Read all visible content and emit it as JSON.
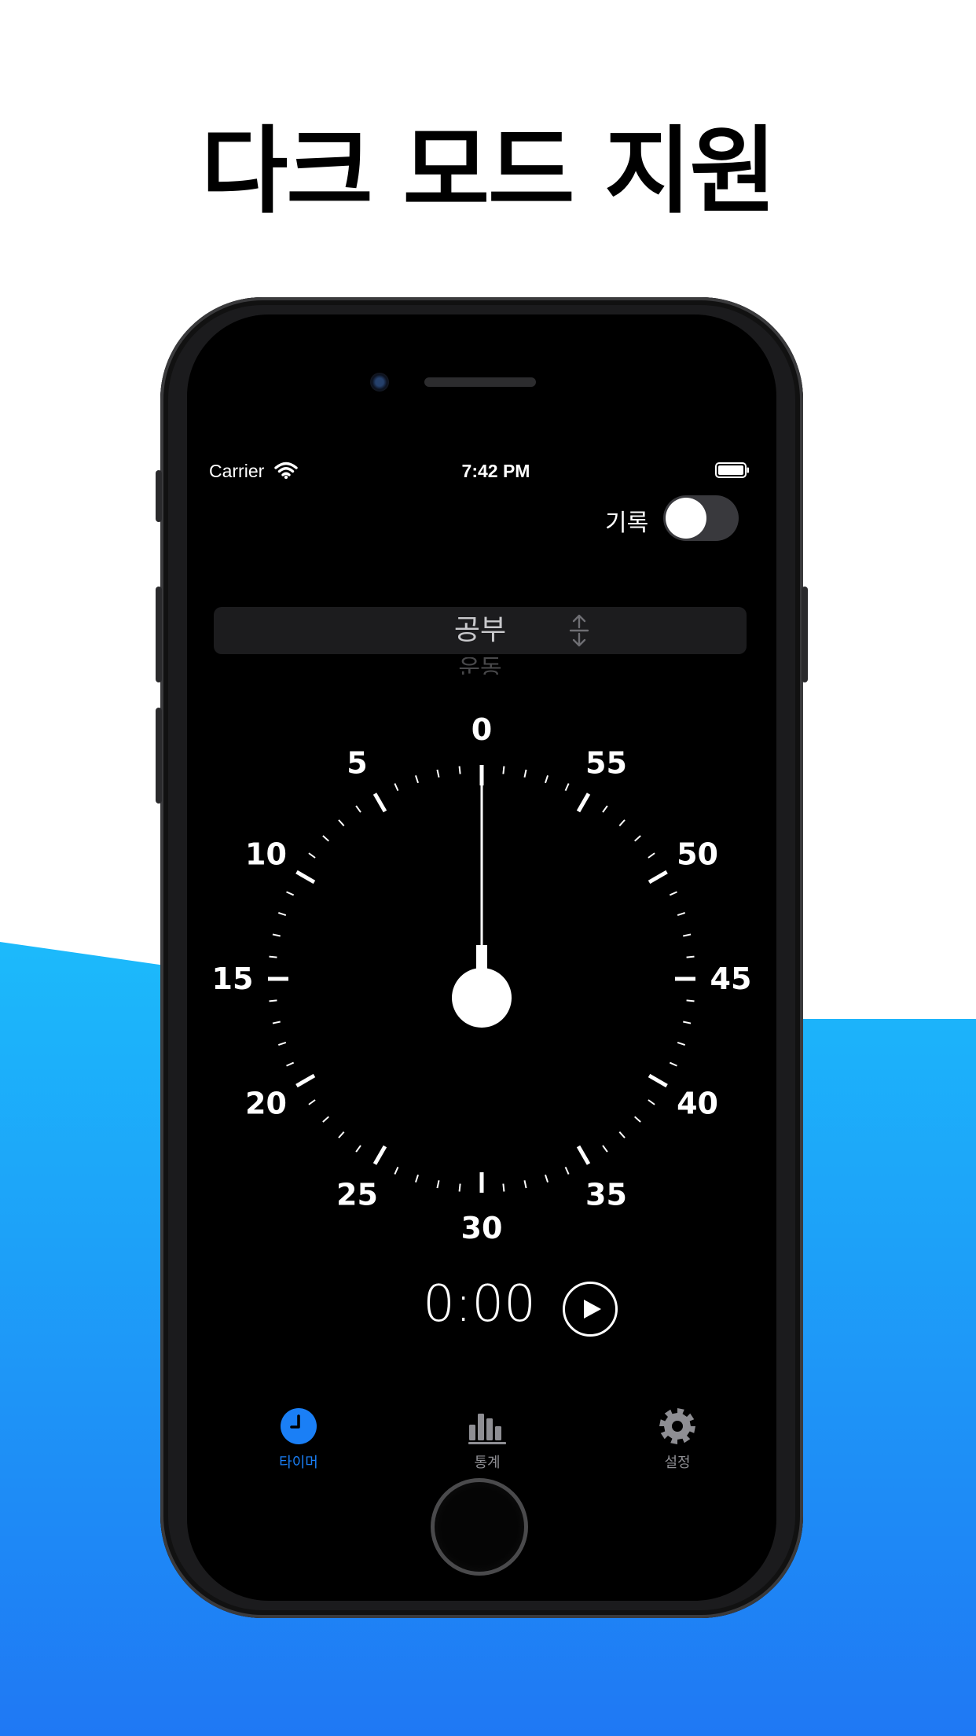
{
  "headline": "다크 모드 지원",
  "colors": {
    "accent": "#1a7ff6",
    "gradient_top": "#1cbafb",
    "gradient_bottom": "#1f78f4",
    "tab_inactive": "#8e8e93"
  },
  "status_bar": {
    "carrier": "Carrier",
    "time": "7:42 PM",
    "icons": [
      "wifi-icon",
      "battery-icon"
    ]
  },
  "record": {
    "label": "기록",
    "enabled": false
  },
  "mode_picker": {
    "selected": "공부",
    "next": "운동",
    "icon": "up-down-arrows-icon"
  },
  "dial": {
    "labels": [
      "0",
      "5",
      "10",
      "15",
      "20",
      "25",
      "30",
      "35",
      "40",
      "45",
      "50",
      "55"
    ],
    "hand_value_minutes": 0
  },
  "timer": {
    "display": "0:00",
    "play_icon": "play-icon"
  },
  "tabs": [
    {
      "label": "타이머",
      "icon": "clock-icon",
      "active": true
    },
    {
      "label": "통계",
      "icon": "bar-chart-icon",
      "active": false
    },
    {
      "label": "설정",
      "icon": "gear-icon",
      "active": false
    }
  ]
}
